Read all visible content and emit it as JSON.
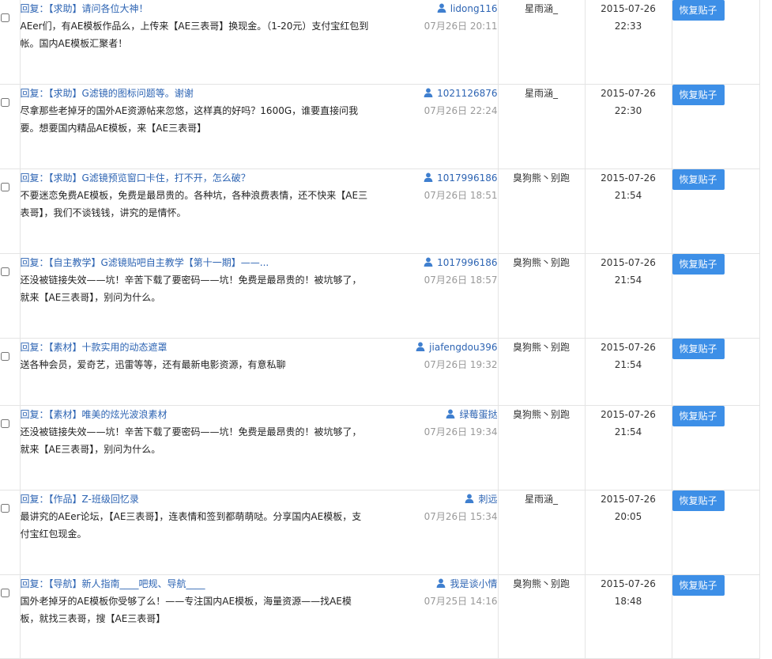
{
  "colors": {
    "link": "#2d64b3",
    "button": "#3d8fe7",
    "time": "#999999",
    "border": "#e4e4e4"
  },
  "icon": "user-icon",
  "rows": [
    {
      "title": "回复：【求助】请问各位大神！",
      "excerpt": "AEer们，有AE模板作品么，上传来【AE三表哥】换现金。（1-20元）支付宝红包到帐。国内AE模板汇聚者！",
      "author": "lidong116",
      "time": "07月26日 20:11",
      "operator": "星雨涵_",
      "date": "2015-07-26",
      "clock": "22:33",
      "button": "恢复贴子"
    },
    {
      "title": "回复：【求助】G滤镜的图标问题等。谢谢",
      "excerpt": "尽拿那些老掉牙的国外AE资源帖来忽悠，这样真的好吗？1600G，谁要直接问我要。想要国内精品AE模板，来【AE三表哥】",
      "author": "1021126876",
      "time": "07月26日 22:24",
      "operator": "星雨涵_",
      "date": "2015-07-26",
      "clock": "22:30",
      "button": "恢复贴子"
    },
    {
      "title": "回复：【求助】G滤镜预览窗口卡住，打不开，怎么破？",
      "excerpt": "不要迷恋免费AE模板，免费是最昂贵的。各种坑，各种浪费表情，还不快来【AE三表哥】，我们不谈钱钱，讲究的是情怀。",
      "author": "1017996186",
      "time": "07月26日 18:51",
      "operator": "臭狗熊丶别跑",
      "date": "2015-07-26",
      "clock": "21:54",
      "button": "恢复贴子"
    },
    {
      "title": "回复：【自主教学】G滤镜贴吧自主教学【第十一期】——...",
      "excerpt": "还没被链接失效——坑！辛苦下载了要密码——坑！免费是最昂贵的！被坑够了，就来【AE三表哥】，别问为什么。",
      "author": "1017996186",
      "time": "07月26日 18:57",
      "operator": "臭狗熊丶别跑",
      "date": "2015-07-26",
      "clock": "21:54",
      "button": "恢复贴子"
    },
    {
      "title": "回复：【素材】十款实用的动态遮罩",
      "excerpt": "送各种会员，爱奇艺，迅雷等等，还有最新电影资源，有意私聊",
      "author": "jiafengdou396",
      "time": "07月26日 19:32",
      "operator": "臭狗熊丶别跑",
      "date": "2015-07-26",
      "clock": "21:54",
      "button": "恢复贴子"
    },
    {
      "title": "回复：【素材】唯美的炫光波浪素材",
      "excerpt": "还没被链接失效——坑！辛苦下载了要密码——坑！免费是最昂贵的！被坑够了，就来【AE三表哥】，别问为什么。",
      "author": "绿莓蛋挞",
      "time": "07月26日 19:34",
      "operator": "臭狗熊丶别跑",
      "date": "2015-07-26",
      "clock": "21:54",
      "button": "恢复贴子"
    },
    {
      "title": "回复：【作品】Z-班级回忆录",
      "excerpt": "最讲究的AEer论坛，【AE三表哥】，连表情和签到都萌萌哒。分享国内AE模板，支付宝红包现金。",
      "author": "刺远",
      "time": "07月26日 15:34",
      "operator": "星雨涵_",
      "date": "2015-07-26",
      "clock": "20:05",
      "button": "恢复贴子"
    },
    {
      "title": "回复：【导航】新人指南____吧规、导航____",
      "excerpt": "国外老掉牙的AE模板你受够了么！——专注国内AE模板，海量资源——找AE模板，就找三表哥，搜【AE三表哥】",
      "author": "我是谈小情",
      "time": "07月25日 14:16",
      "operator": "臭狗熊丶别跑",
      "date": "2015-07-26",
      "clock": "18:48",
      "button": "恢复贴子"
    }
  ]
}
